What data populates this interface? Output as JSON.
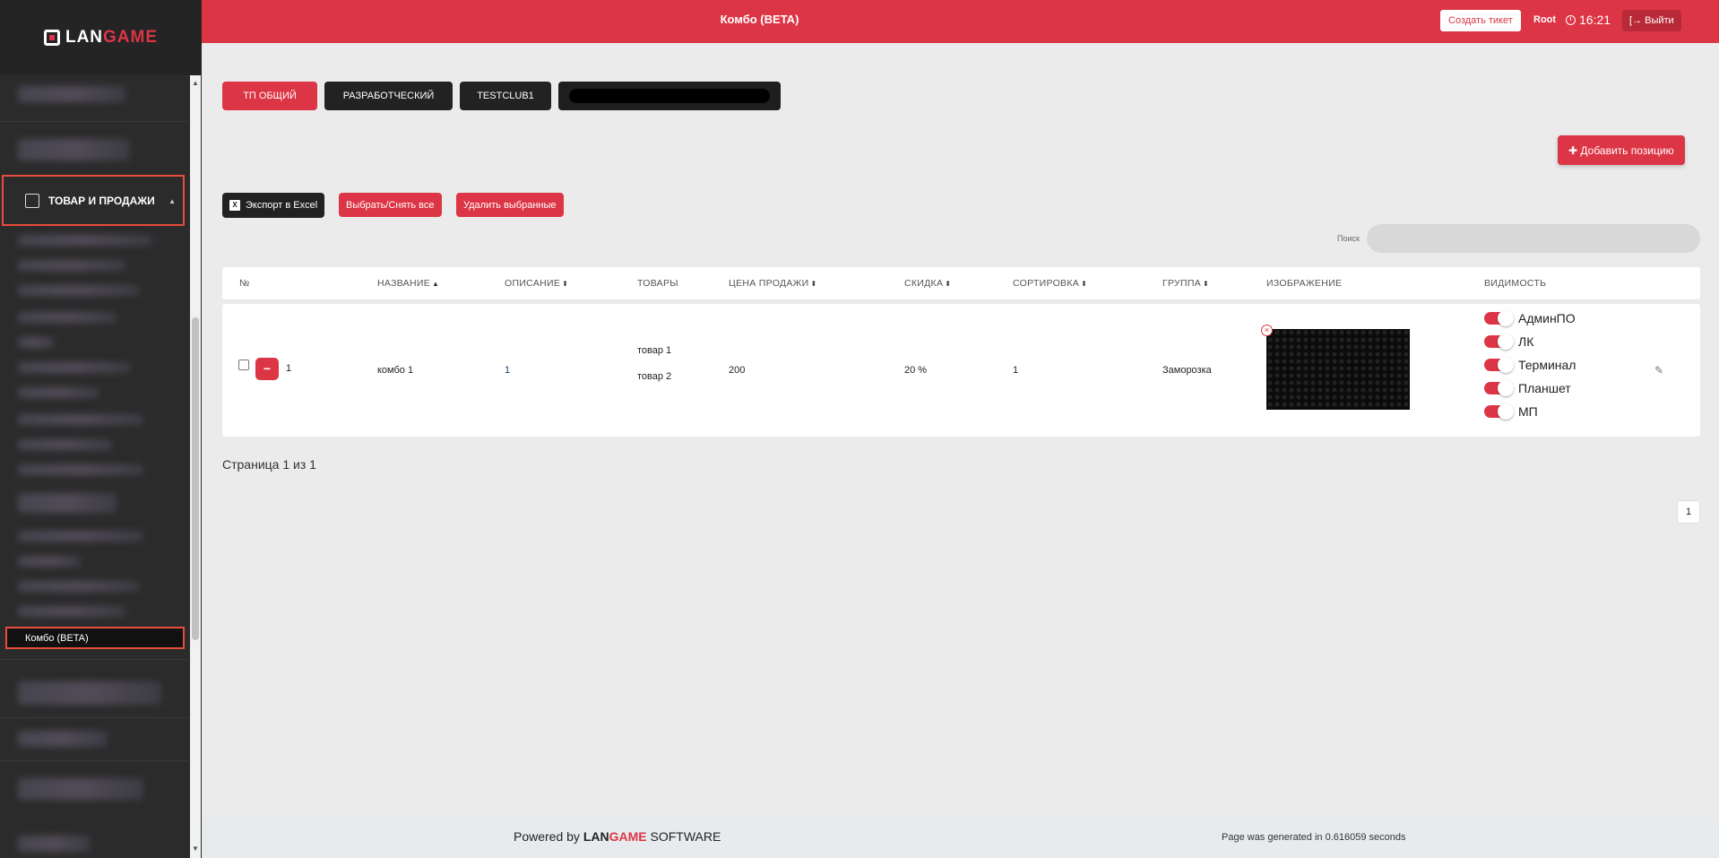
{
  "app": {
    "logo_lan": "LAN",
    "logo_game": "GAME",
    "page_title": "Комбо (BETA)"
  },
  "header": {
    "create_ticket": "Создать тикет",
    "user": "Root",
    "time": "16:21",
    "logout": "Выйти"
  },
  "sidebar": {
    "section_label": "ТОВАР И ПРОДАЖИ",
    "active_item": "Комбо (BETA)"
  },
  "tabs": [
    {
      "label": "ТП ОБЩИЙ",
      "active": true
    },
    {
      "label": "РАЗРАБОТЧЕСКИЙ",
      "active": false
    },
    {
      "label": "TESTCLUB1",
      "active": false
    }
  ],
  "toolbar": {
    "add_position": "Добавить позицию",
    "export_excel": "Экспорт в Excel",
    "select_all": "Выбрать/Снять все",
    "delete_selected": "Удалить выбранные",
    "search_label": "Поиск",
    "search_placeholder": ""
  },
  "table": {
    "columns": [
      "№",
      "НАЗВАНИЕ",
      "ОПИСАНИЕ",
      "ТОВАРЫ",
      "ЦЕНА ПРОДАЖИ",
      "СКИДКА",
      "СОРТИРОВКА",
      "ГРУППА",
      "ИЗОБРАЖЕНИЕ",
      "ВИДИМОСТЬ"
    ],
    "rows": [
      {
        "num": "1",
        "name": "комбо 1",
        "description": "1",
        "products": [
          "товар 1",
          "товар 2"
        ],
        "price": "200",
        "discount": "20 %",
        "sort": "1",
        "group": "Заморозка",
        "visibility": [
          "АдминПО",
          "ЛК",
          "Терминал",
          "Планшет",
          "МП"
        ]
      }
    ]
  },
  "pagination": {
    "info": "Страница 1 из 1",
    "current": "1"
  },
  "footer": {
    "powered_by": "Powered by",
    "brand_lan": "LAN",
    "brand_game": "GAME",
    "brand_software": "SOFTWARE",
    "generated": "Page was generated in 0.616059 seconds"
  },
  "colors": {
    "accent": "#dc3545",
    "sidebar": "#2b2b2b",
    "background": "#ebebeb"
  }
}
